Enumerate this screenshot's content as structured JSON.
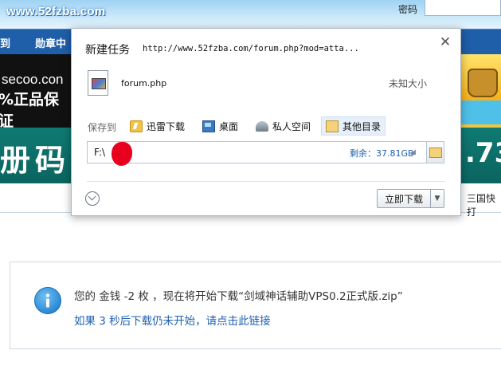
{
  "site": {
    "logo": "www.52fzba.com",
    "password_label": "密码",
    "nav": {
      "item_left": "到",
      "item_medals": "勋章中"
    },
    "ad_left": {
      "line1": "secoo.con",
      "line2": "%正品保证"
    },
    "banner_text": "册码寄",
    "banner_number": ".73",
    "quick_link": "三国快打"
  },
  "notice": {
    "line1": "您的 金钱 -2 枚 ，现在将开始下载“剑域神话辅助VPS0.2正式版.zip”",
    "line2": "如果 3 秒后下载仍未开始，请点击此链接"
  },
  "dialog": {
    "title": "新建任务",
    "url": "http://www.52fzba.com/forum.php?mod=atta...",
    "close_symbol": "✕",
    "file_name": "forum.php",
    "file_size": "未知大小",
    "save_to_label": "保存到",
    "locations": [
      {
        "label": "迅雷下载",
        "icon": "thunder-folder-icon"
      },
      {
        "label": "桌面",
        "icon": "desktop-icon"
      },
      {
        "label": "私人空间",
        "icon": "private-space-icon"
      },
      {
        "label": "其他目录",
        "icon": "folder-icon",
        "selected": true
      }
    ],
    "path_value": "F:\\",
    "free_space": "剩余：37.81GB",
    "download_button": "立即下载",
    "dropdown_symbol": "▼"
  },
  "colors": {
    "nav_blue": "#1f5ea8",
    "banner_teal": "#0f7a73",
    "link_blue": "#1d5fb3",
    "redaction_red": "#e8001f"
  }
}
